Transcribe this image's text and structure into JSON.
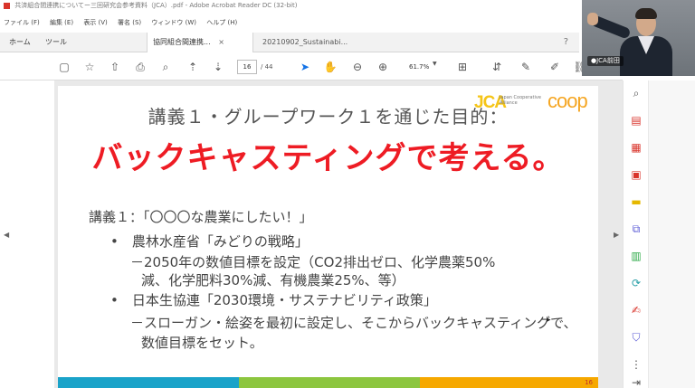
{
  "window": {
    "title": "共済組合間連携についてー三回研究会参考資料（JCA）.pdf - Adobe Acrobat Reader DC (32-bit)"
  },
  "menu": [
    "ファイル (F)",
    "編集 (E)",
    "表示 (V)",
    "署名 (S)",
    "ウィンドウ (W)",
    "ヘルプ (H)"
  ],
  "tabs": {
    "home": "ホーム",
    "tools": "ツール",
    "doc1": "協同組合間連携...",
    "doc2": "20210902_Sustainabi...",
    "close": "×"
  },
  "toolbar": {
    "page_current": "16",
    "page_total": "/ 44",
    "zoom": "61.7%"
  },
  "webcam": {
    "name_tag": "●JCA前田"
  },
  "slide": {
    "logo_jca": "JCA",
    "logo_jca_sub": "Japan Cooperative Alliance",
    "logo_coop": "coop",
    "title": "講義１・グループワーク１を通じた目的：",
    "headline": "バックキャスティングで考える。",
    "lines": [
      "講義１：「〇〇〇な農業にしたい！」",
      "•　農林水産省「みどりの戦略」",
      "－2050年の数値目標を設定（CO2排出ゼロ、化学農薬50%",
      "減、化学肥料30%減、有機農業25%、等）",
      "•　日本生協連「2030環境・サステナビリティ政策」",
      "－スローガン・絵姿を最初に設定し、そこからバックキャスティングで、",
      "数値目標をセット。"
    ],
    "page_number": "16"
  },
  "colors": {
    "headline": "#ee1c24",
    "footer_blue": "#1aa3c9",
    "footer_green": "#8cc63f",
    "footer_orange": "#f6a800"
  }
}
